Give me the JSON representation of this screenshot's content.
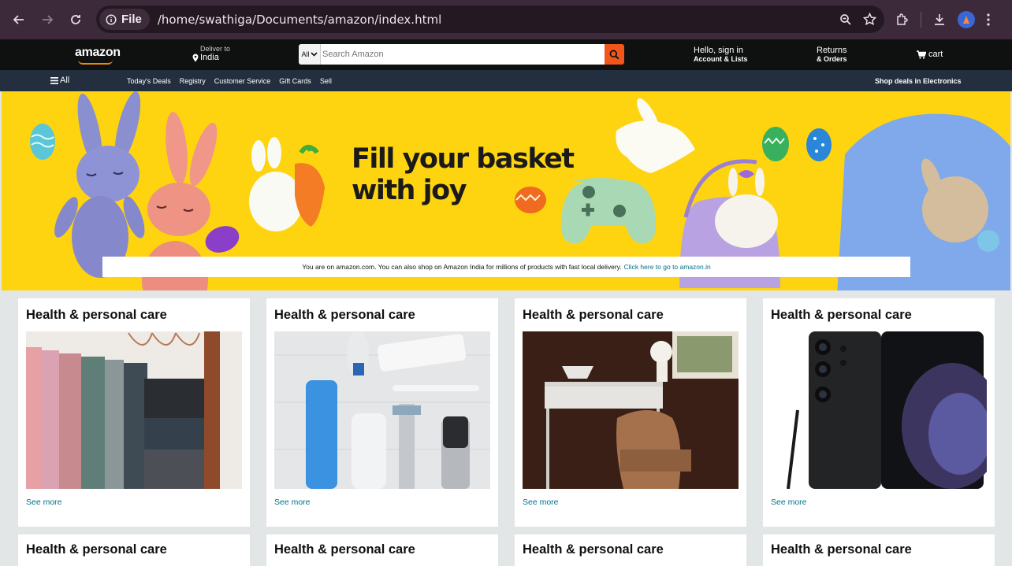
{
  "browser": {
    "file_chip": "File",
    "url": "/home/swathiga/Documents/amazon/index.html"
  },
  "header": {
    "logo": "amazon",
    "deliver_to": "Deliver to",
    "location": "India",
    "search_category": "All",
    "search_placeholder": "Search Amazon",
    "account_line1": "Hello, sign in",
    "account_line2": "Account & Lists",
    "returns_line1": "Returns",
    "returns_line2": "& Orders",
    "cart": "cart"
  },
  "subnav": {
    "all": "All",
    "links": [
      "Today's Deals",
      "Registry",
      "Customer Service",
      "Gift Cards",
      "Sell"
    ],
    "promo": "Shop deals in Electronics"
  },
  "hero": {
    "title_line1": "Fill your basket",
    "title_line2": "with joy",
    "notice_text": "You are on amazon.com. You can also shop on Amazon India for millions of products with fast local delivery.",
    "notice_link": "Click here to go to amazon.in"
  },
  "cards": [
    {
      "title": "Health & personal care",
      "link": "See more",
      "image": "towels"
    },
    {
      "title": "Health & personal care",
      "link": "See more",
      "image": "toiletries"
    },
    {
      "title": "Health & personal care",
      "link": "See more",
      "image": "desk"
    },
    {
      "title": "Health & personal care",
      "link": "See more",
      "image": "phone"
    }
  ],
  "cards_row2": [
    {
      "title": "Health & personal care"
    },
    {
      "title": "Health & personal care"
    },
    {
      "title": "Health & personal care"
    },
    {
      "title": "Health & personal care"
    }
  ],
  "colors": {
    "nav_dark": "#0f1111",
    "subnav": "#232f3e",
    "hero_yellow": "#fdd40f",
    "search_button": "#f1561b",
    "link": "#007185",
    "smile": "#f08804"
  }
}
